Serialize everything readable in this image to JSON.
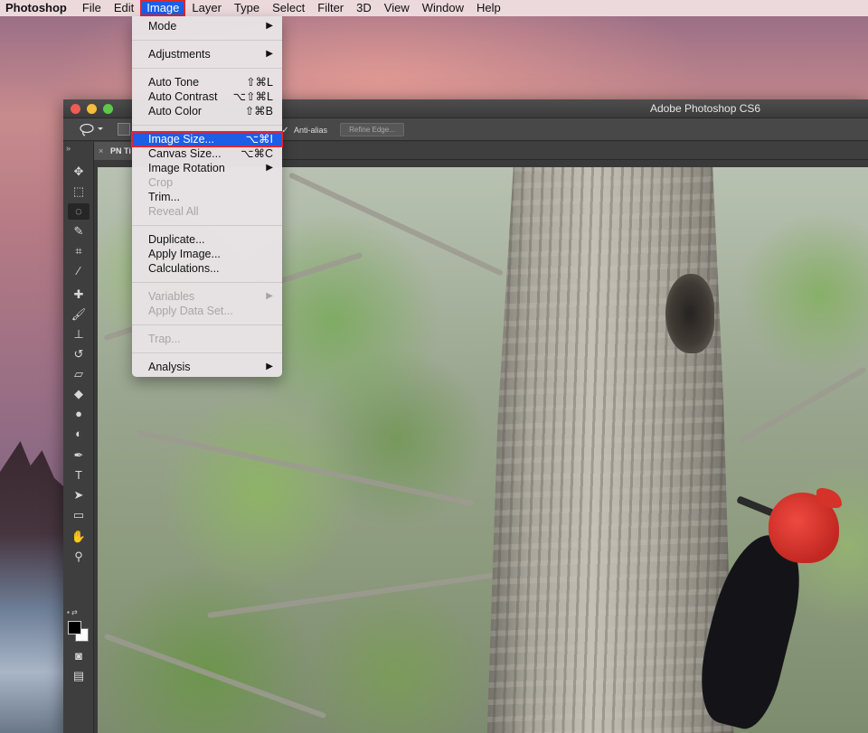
{
  "menubar": {
    "app_name": "Photoshop",
    "items": [
      "File",
      "Edit",
      "Image",
      "Layer",
      "Type",
      "Select",
      "Filter",
      "3D",
      "View",
      "Window",
      "Help"
    ],
    "active_item": "Image"
  },
  "image_menu": {
    "mode": "Mode",
    "adjustments": "Adjustments",
    "auto_tone": "Auto Tone",
    "auto_tone_sc": "⇧⌘L",
    "auto_contrast": "Auto Contrast",
    "auto_contrast_sc": "⌥⇧⌘L",
    "auto_color": "Auto Color",
    "auto_color_sc": "⇧⌘B",
    "image_size": "Image Size...",
    "image_size_sc": "⌥⌘I",
    "canvas_size": "Canvas Size...",
    "canvas_size_sc": "⌥⌘C",
    "image_rotation": "Image Rotation",
    "crop": "Crop",
    "trim": "Trim...",
    "reveal_all": "Reveal All",
    "duplicate": "Duplicate...",
    "apply_image": "Apply Image...",
    "calculations": "Calculations...",
    "variables": "Variables",
    "apply_data_set": "Apply Data Set...",
    "trap": "Trap...",
    "analysis": "Analysis",
    "submenu_arrow": "▶",
    "highlighted_item": "Image Size..."
  },
  "window": {
    "title": "Adobe Photoshop CS6"
  },
  "options_bar": {
    "anti_alias_label": "Anti-alias",
    "anti_alias_checked": true,
    "refine_edge_label": "Refine Edge..."
  },
  "document": {
    "tab_label": "PN Ti"
  },
  "toolbox": {
    "tools": [
      "move",
      "marquee",
      "lasso",
      "quick-selection",
      "crop",
      "eyedropper",
      "healing-brush",
      "brush",
      "clone-stamp",
      "history-brush",
      "eraser",
      "paint-bucket",
      "blur",
      "dodge",
      "pen",
      "type",
      "path-selection",
      "rectangle",
      "hand",
      "zoom"
    ],
    "selected_tool": "lasso",
    "foreground_color": "#000000",
    "background_color": "#ffffff"
  },
  "colors": {
    "menu_highlight": "#1d5ee6",
    "highlight_outline": "#e0262d"
  }
}
